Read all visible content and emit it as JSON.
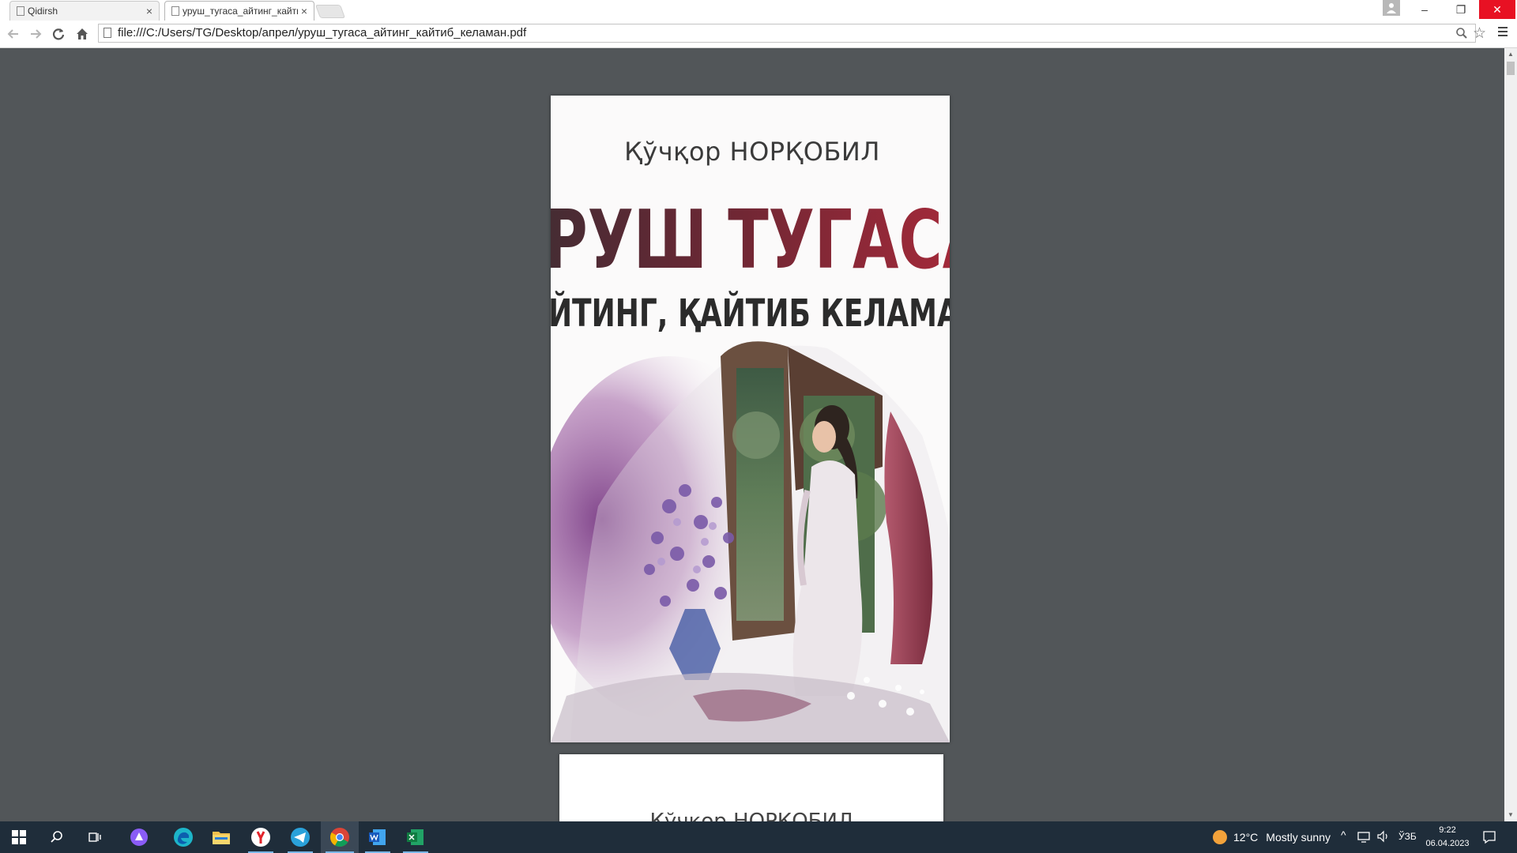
{
  "window": {
    "tabs": [
      {
        "label": "Qidirsh",
        "active": false
      },
      {
        "label": "уруш_тугаса_айтинг_кайтиб_келаман.pdf",
        "active": true
      }
    ],
    "buttons": {
      "minimize": "–",
      "restore": "❐",
      "close": "✕"
    }
  },
  "toolbar": {
    "url": "file:///C:/Users/TG/Desktop/апрел/уруш_тугаса_айтинг_кайтиб_келаман.pdf"
  },
  "document": {
    "cover": {
      "author": "Қўчқор НОРҚОБИЛ",
      "title_line1": "УРУШ ТУГАСА,",
      "title_line2": "АЙТИНГ, ҚАЙТИБ КЕЛАМАН"
    },
    "page2_header": "Қўчқор НОРҚОБИЛ"
  },
  "taskbar": {
    "apps": [
      "start-icon",
      "search-icon",
      "task-view-icon",
      "cortana-icon",
      "edge-icon",
      "file-explorer-icon",
      "yandex-icon",
      "telegram-icon",
      "chrome-icon",
      "word-icon",
      "excel-icon"
    ],
    "weather": {
      "temp": "12°C",
      "desc": "Mostly sunny"
    },
    "language": "ЎЗБ",
    "time": "9:22",
    "date": "06.04.2023"
  },
  "colors": {
    "viewer_bg": "#525659",
    "taskbar_bg": "#1f2d3a",
    "title_red": "#8e2430",
    "title_dark": "#2b2b2b"
  }
}
